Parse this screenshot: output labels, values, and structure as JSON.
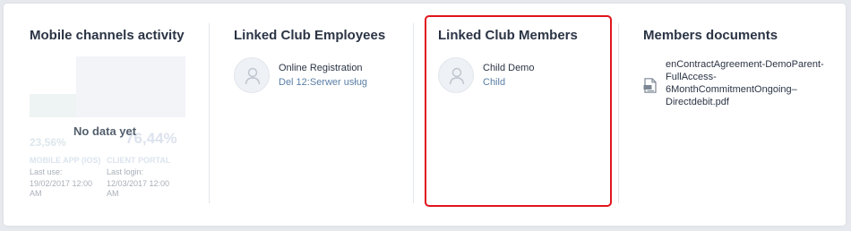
{
  "mobile": {
    "title": "Mobile channels activity",
    "no_data": "No data yet",
    "pct_mobile": "23,56%",
    "pct_client": "76,44%",
    "label_mobile": "MOBILE APP (IOS)",
    "label_client": "CLIENT PORTAL",
    "last_use_label": "Last use:",
    "last_use_value": "19/02/2017 12:00 AM",
    "last_login_label": "Last login:",
    "last_login_value": "12/03/2017 12:00 AM"
  },
  "employees": {
    "title": "Linked Club Employees",
    "items": [
      {
        "name": "Online Registration",
        "sub": "Del 12:Serwer usług"
      }
    ]
  },
  "members": {
    "title": "Linked Club Members",
    "items": [
      {
        "name": "Child Demo",
        "sub": "Child"
      }
    ]
  },
  "documents": {
    "title": "Members documents",
    "items": [
      {
        "lines": [
          "enContractAgreement-DemoParent-",
          "FullAccess-",
          "6MonthCommitmentOngoing–",
          "Directdebit.pdf"
        ],
        "icon": "pdf-file-icon"
      }
    ]
  },
  "colors": {
    "highlight": "#e0151c",
    "link": "#5a7fa6"
  }
}
